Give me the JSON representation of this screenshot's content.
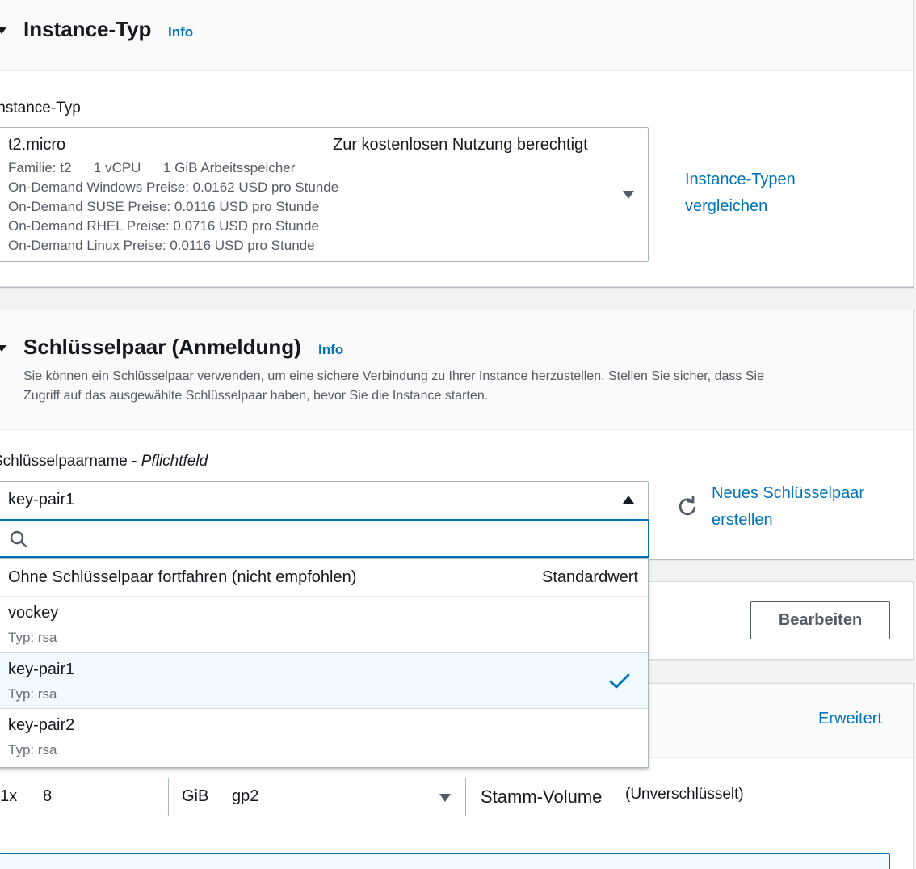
{
  "instance_section": {
    "title": "Instance-Typ",
    "info": "Info",
    "field_label": "Instance-Typ",
    "selected": {
      "name": "t2.micro",
      "badge": "Zur kostenlosen Nutzung berechtigt",
      "family": "Familie: t2",
      "vcpu": "1 vCPU",
      "memory": "1 GiB Arbeitsspeicher",
      "price_windows": "On-Demand Windows Preise: 0.0162 USD pro Stunde",
      "price_suse": "On-Demand SUSE Preise: 0.0116 USD pro Stunde",
      "price_rhel": "On-Demand RHEL Preise: 0.0716 USD pro Stunde",
      "price_linux": "On-Demand Linux Preise: 0.0116 USD pro Stunde"
    },
    "compare_link_line1": "Instance-Typen",
    "compare_link_line2": "vergleichen"
  },
  "keypair_section": {
    "title": "Schlüsselpaar (Anmeldung)",
    "info": "Info",
    "description_line1": "Sie können ein Schlüsselpaar verwenden, um eine sichere Verbindung zu Ihrer Instance herzustellen. Stellen Sie sicher, dass Sie",
    "description_line2": "Zugriff auf das ausgewählte Schlüsselpaar haben, bevor Sie die Instance starten.",
    "field_label": "Schlüsselpaarname - ",
    "field_required": "Pflichtfeld",
    "selected_value": "key-pair1",
    "search_placeholder": "",
    "new_link_line1": "Neues Schlüsselpaar",
    "new_link_line2": "erstellen"
  },
  "dropdown": {
    "options": [
      {
        "name": "Ohne Schlüsselpaar fortfahren (nicht empfohlen)",
        "tag": "Standardwert"
      },
      {
        "name": "vockey",
        "sub": "Typ: rsa"
      },
      {
        "name": "key-pair1",
        "sub": "Typ: rsa",
        "selected": true
      },
      {
        "name": "key-pair2",
        "sub": "Typ: rsa"
      }
    ]
  },
  "network_section": {
    "edit_button": "Bearbeiten"
  },
  "storage_section": {
    "advanced_link": "Erweitert",
    "count": "1x",
    "size_value": "8",
    "unit": "GiB",
    "volume_type": "gp2",
    "root_volume_label": "Stamm-Volume",
    "encryption_note": "(Unverschlüsselt)"
  },
  "colors": {
    "link": "#0073bb",
    "selected_row_bg": "#f1faff",
    "focus": "#0073bb"
  }
}
